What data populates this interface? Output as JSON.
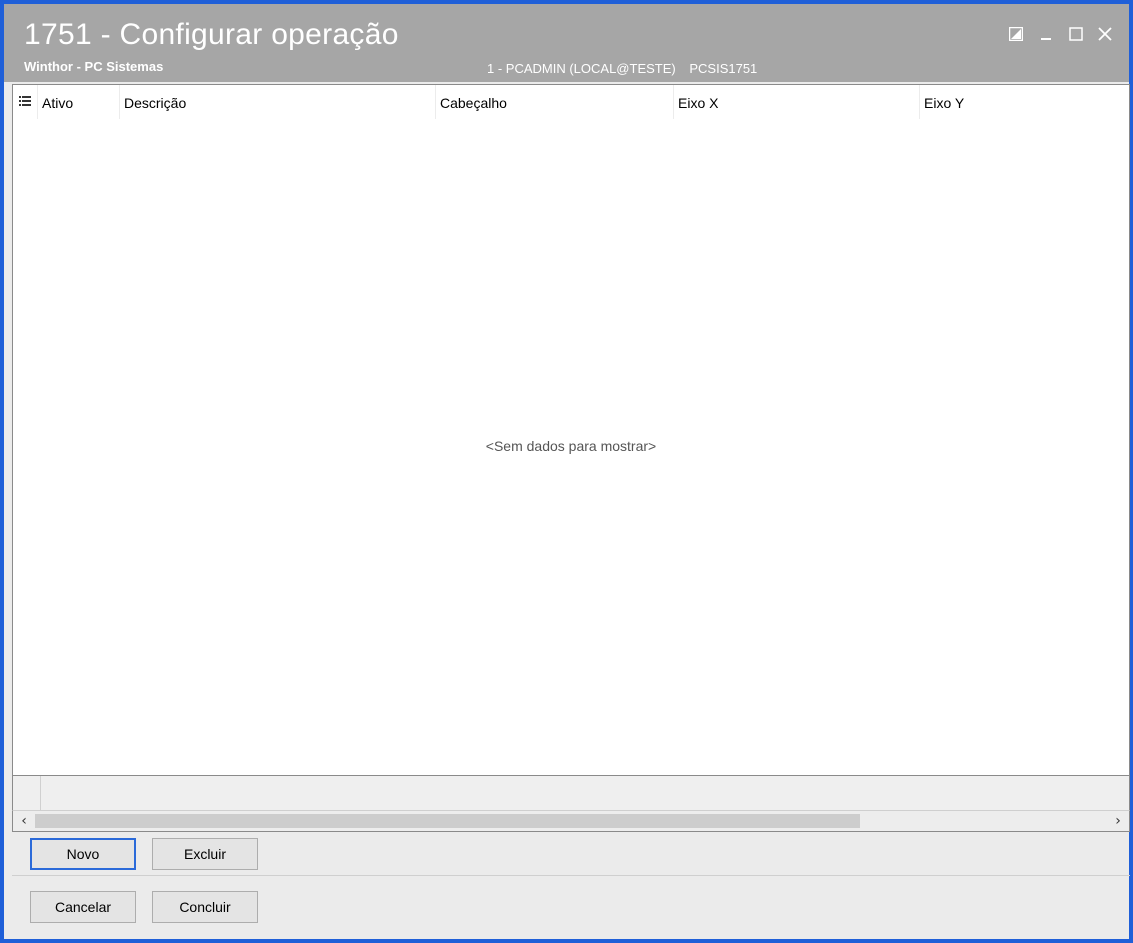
{
  "window": {
    "title": "1751 - Configurar operação",
    "subtitle": "Winthor - PC Sistemas",
    "user": "1 - PCADMIN (LOCAL@TESTE)",
    "module": "PCSIS1751",
    "accent_color": "#1f5fd8",
    "titlebar_color": "#a6a6a6"
  },
  "window_controls": [
    {
      "name": "restore-edit-icon"
    },
    {
      "name": "minimize-icon"
    },
    {
      "name": "maximize-icon"
    },
    {
      "name": "close-icon"
    }
  ],
  "grid": {
    "columns": [
      "Ativo",
      "Descrição",
      "Cabeçalho",
      "Eixo X",
      "Eixo Y"
    ],
    "empty_message": "<Sem dados para mostrar>"
  },
  "actions": {
    "new_label": "Novo",
    "delete_label": "Excluir",
    "cancel_label": "Cancelar",
    "finish_label": "Concluir"
  }
}
